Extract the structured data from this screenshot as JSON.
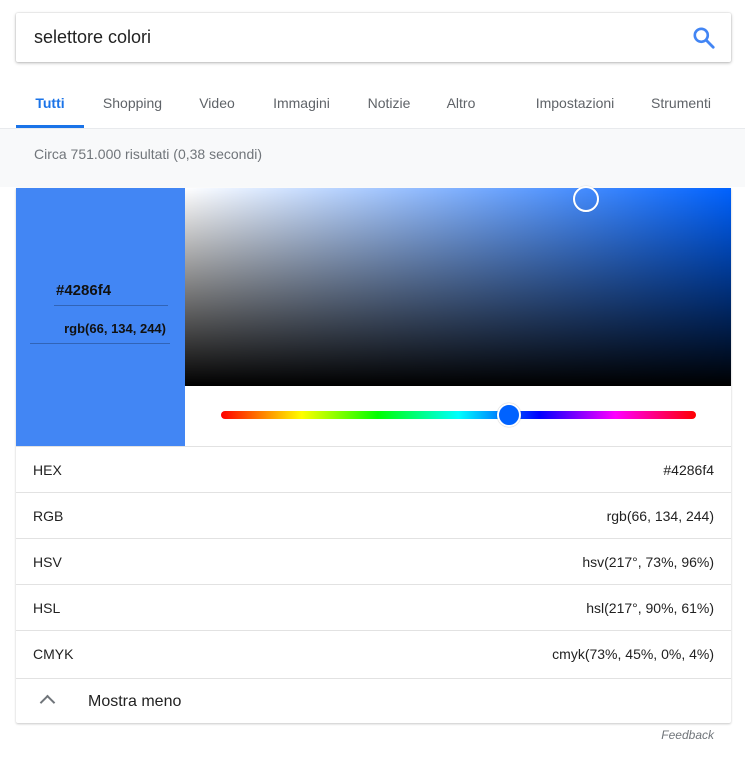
{
  "search": {
    "query": "selettore colori",
    "icon": "search-icon",
    "accent": "#4285f4"
  },
  "tabs": [
    {
      "label": "Tutti",
      "active": true
    },
    {
      "label": "Shopping"
    },
    {
      "label": "Video"
    },
    {
      "label": "Immagini"
    },
    {
      "label": "Notizie"
    },
    {
      "label": "Altro"
    },
    {
      "label": "Impostazioni"
    },
    {
      "label": "Strumenti"
    }
  ],
  "result_stats": "Circa 751.000 risultati (0,38 secondi)",
  "color_picker": {
    "selected_color": "#4286f4",
    "hex_input": "#4286f4",
    "rgb_input": "rgb(66, 134, 244)",
    "hue_degrees": 217,
    "saturation_percent": 73,
    "value_percent": 96,
    "rows": [
      {
        "label": "HEX",
        "value": "#4286f4"
      },
      {
        "label": "RGB",
        "value": "rgb(66, 134, 244)"
      },
      {
        "label": "HSV",
        "value": "hsv(217°, 73%, 96%)"
      },
      {
        "label": "HSL",
        "value": "hsl(217°, 90%, 61%)"
      },
      {
        "label": "CMYK",
        "value": "cmyk(73%, 45%, 0%, 4%)"
      }
    ],
    "show_less_label": "Mostra meno",
    "show_less_icon": "chevron-up-icon"
  },
  "feedback_label": "Feedback"
}
